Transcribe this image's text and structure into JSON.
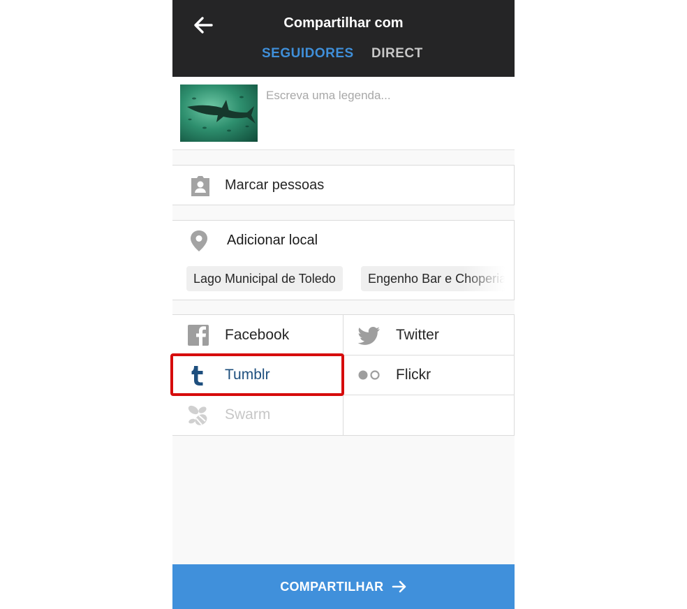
{
  "header": {
    "title": "Compartilhar com",
    "tabs": [
      {
        "label": "SEGUIDORES",
        "active": true
      },
      {
        "label": "DIRECT",
        "active": false
      }
    ],
    "back_icon": "arrow-left-icon"
  },
  "caption": {
    "placeholder": "Escreva uma legenda...",
    "value": ""
  },
  "tag_people": {
    "label": "Marcar pessoas",
    "icon": "person-tag-icon"
  },
  "location": {
    "label": "Adicionar local",
    "icon": "location-pin-icon",
    "suggestions": [
      "Lago Municipal de Toledo",
      "Engenho Bar e Choperia"
    ]
  },
  "share_targets": [
    {
      "label": "Facebook",
      "icon": "facebook-icon",
      "enabled": true
    },
    {
      "label": "Twitter",
      "icon": "twitter-icon",
      "enabled": true
    },
    {
      "label": "Tumblr",
      "icon": "tumblr-icon",
      "enabled": true,
      "highlighted": true
    },
    {
      "label": "Flickr",
      "icon": "flickr-icon",
      "enabled": true
    },
    {
      "label": "Swarm",
      "icon": "swarm-icon",
      "enabled": false
    }
  ],
  "share_button": {
    "label": "COMPARTILHAR",
    "icon": "arrow-right-icon"
  },
  "colors": {
    "header_bg": "#252526",
    "accent_blue": "#4090db",
    "tab_active": "#3f8fd9",
    "tumblr_blue": "#1e4f7e",
    "highlight_red": "#d60c0c",
    "disabled_text": "#c7c7c7"
  }
}
